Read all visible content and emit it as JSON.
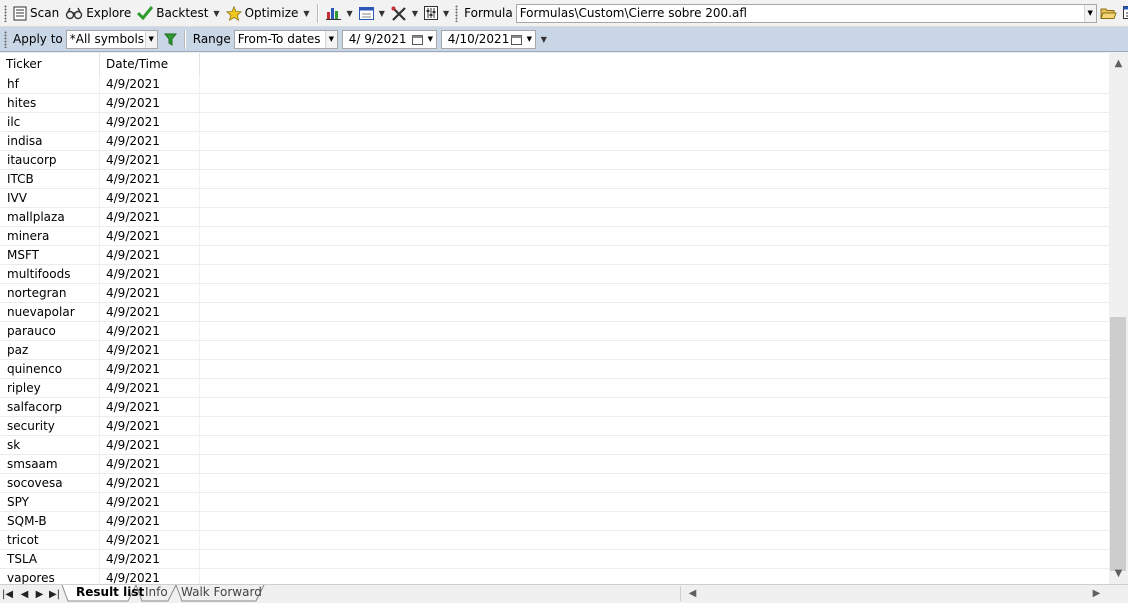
{
  "toolbar": {
    "scan_label": "Scan",
    "explore_label": "Explore",
    "backtest_label": "Backtest",
    "optimize_label": "Optimize",
    "formula_label": "Formula",
    "formula_value": "Formulas\\Custom\\Cierre sobre 200.afl"
  },
  "filterbar": {
    "apply_to_label": "Apply to",
    "apply_to_value": "*All symbols",
    "range_label": "Range",
    "range_value": "From-To dates",
    "from_date": "4/  9/2021",
    "to_date": "4/10/2021"
  },
  "grid": {
    "columns": [
      "Ticker",
      "Date/Time"
    ],
    "rows": [
      [
        "hf",
        "4/9/2021"
      ],
      [
        "hites",
        "4/9/2021"
      ],
      [
        "ilc",
        "4/9/2021"
      ],
      [
        "indisa",
        "4/9/2021"
      ],
      [
        "itaucorp",
        "4/9/2021"
      ],
      [
        "ITCB",
        "4/9/2021"
      ],
      [
        "IVV",
        "4/9/2021"
      ],
      [
        "mallplaza",
        "4/9/2021"
      ],
      [
        "minera",
        "4/9/2021"
      ],
      [
        "MSFT",
        "4/9/2021"
      ],
      [
        "multifoods",
        "4/9/2021"
      ],
      [
        "nortegran",
        "4/9/2021"
      ],
      [
        "nuevapolar",
        "4/9/2021"
      ],
      [
        "parauco",
        "4/9/2021"
      ],
      [
        "paz",
        "4/9/2021"
      ],
      [
        "quinenco",
        "4/9/2021"
      ],
      [
        "ripley",
        "4/9/2021"
      ],
      [
        "salfacorp",
        "4/9/2021"
      ],
      [
        "security",
        "4/9/2021"
      ],
      [
        "sk",
        "4/9/2021"
      ],
      [
        "smsaam",
        "4/9/2021"
      ],
      [
        "socovesa",
        "4/9/2021"
      ],
      [
        "SPY",
        "4/9/2021"
      ],
      [
        "SQM-B",
        "4/9/2021"
      ],
      [
        "tricot",
        "4/9/2021"
      ],
      [
        "TSLA",
        "4/9/2021"
      ],
      [
        "vapores",
        "4/9/2021"
      ]
    ]
  },
  "tabs": {
    "result_list": "Result list",
    "info": "Info",
    "walk_forward": "Walk Forward"
  },
  "colors": {
    "filterbar_bg": "#c9d6e6",
    "scrollbar_thumb": "#cdcdcd",
    "backtest_check": "#2e9b2e",
    "optimize_star": "#f2c81e"
  }
}
